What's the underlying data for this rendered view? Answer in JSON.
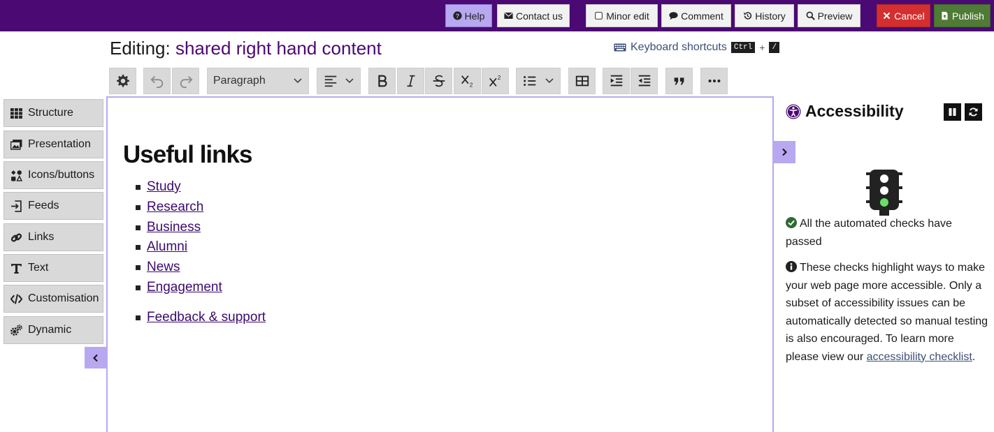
{
  "topbar": {
    "help_label": "Help",
    "contact_label": "Contact us",
    "minor_edit_label": "Minor edit",
    "comment_label": "Comment",
    "history_label": "History",
    "preview_label": "Preview",
    "cancel_label": "Cancel",
    "publish_label": "Publish"
  },
  "header": {
    "editing_prefix": "Editing:",
    "page_name": "shared right hand content",
    "keyboard_shortcuts_label": "Keyboard shortcuts",
    "shortcut_key1": "Ctrl",
    "shortcut_plus": "+",
    "shortcut_key2": "/"
  },
  "toolbar": {
    "block_format": "Paragraph"
  },
  "sidebar": {
    "items": [
      {
        "label": "Structure",
        "icon": "grid-icon"
      },
      {
        "label": "Presentation",
        "icon": "images-icon"
      },
      {
        "label": "Icons/buttons",
        "icon": "icons-icon"
      },
      {
        "label": "Feeds",
        "icon": "feed-import-icon"
      },
      {
        "label": "Links",
        "icon": "link-icon"
      },
      {
        "label": "Text",
        "icon": "text-t-icon"
      },
      {
        "label": "Customisation",
        "icon": "code-icon"
      },
      {
        "label": "Dynamic",
        "icon": "cogs-icon"
      }
    ]
  },
  "content": {
    "heading": "Useful links",
    "links": [
      "Study",
      "Research",
      "Business",
      "Alumni",
      "News",
      "Engagement"
    ],
    "extra_link": "Feedback & support"
  },
  "accessibility": {
    "title": "Accessibility",
    "status_text": "All the automated checks have passed",
    "info_text": "These checks highlight ways to make your web page more accessible. Only a subset of accessibility issues can be automatically detected so manual testing is also encouraged. To learn more please view our",
    "checklist_link": "accessibility checklist",
    "info_end": ".",
    "status_color": "#2e7d32"
  },
  "colors": {
    "topbar": "#4b0a73",
    "accent": "#b8a8f0",
    "cancel": "#d32f2f",
    "publish": "#4f7b36"
  }
}
